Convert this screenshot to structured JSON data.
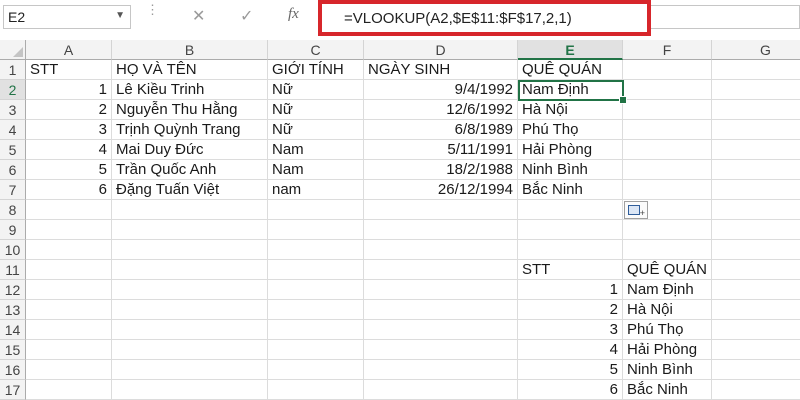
{
  "name_box": {
    "value": "E2"
  },
  "formula_bar": {
    "cancel_icon": "x-icon",
    "enter_icon": "check-icon",
    "fx_label": "fx",
    "formula": "=VLOOKUP(A2,$E$11:$F$17,2,1)"
  },
  "columns": [
    "A",
    "B",
    "C",
    "D",
    "E",
    "F",
    "G"
  ],
  "rows": [
    "1",
    "2",
    "3",
    "4",
    "5",
    "6",
    "7",
    "8",
    "9",
    "10",
    "11",
    "12",
    "13",
    "14",
    "15",
    "16",
    "17"
  ],
  "selected_cell": "E2",
  "headers": {
    "stt": "STT",
    "name": "HỌ VÀ TÊN",
    "gender": "GIỚI TÍNH",
    "dob": "NGÀY SINH",
    "hometown": "QUÊ QUÁN"
  },
  "people": [
    {
      "stt": "1",
      "name": "Lê Kiều Trinh",
      "gender": "Nữ",
      "dob": "9/4/1992",
      "hometown": "Nam Định"
    },
    {
      "stt": "2",
      "name": "Nguyễn Thu Hằng",
      "gender": "Nữ",
      "dob": "12/6/1992",
      "hometown": "Hà Nội"
    },
    {
      "stt": "3",
      "name": "Trịnh Quỳnh Trang",
      "gender": "Nữ",
      "dob": "6/8/1989",
      "hometown": "Phú Thọ"
    },
    {
      "stt": "4",
      "name": "Mai Duy Đức",
      "gender": "Nam",
      "dob": "5/11/1991",
      "hometown": "Hải Phòng"
    },
    {
      "stt": "5",
      "name": "Trần Quốc Anh",
      "gender": "Nam",
      "dob": "18/2/1988",
      "hometown": "Ninh Bình"
    },
    {
      "stt": "6",
      "name": "Đặng Tuấn Việt",
      "gender": "nam",
      "dob": "26/12/1994",
      "hometown": "Bắc Ninh"
    }
  ],
  "lookup_headers": {
    "stt": "STT",
    "hometown": "QUÊ QUÁN"
  },
  "lookup": [
    {
      "stt": "1",
      "hometown": "Nam Định"
    },
    {
      "stt": "2",
      "hometown": "Hà Nội"
    },
    {
      "stt": "3",
      "hometown": "Phú Thọ"
    },
    {
      "stt": "4",
      "hometown": "Hải Phòng"
    },
    {
      "stt": "5",
      "hometown": "Ninh Bình"
    },
    {
      "stt": "6",
      "hometown": "Bắc Ninh"
    }
  ],
  "paste_options_icon": "paste-options-icon",
  "colors": {
    "accent": "#217346",
    "highlight_border": "#d7262b"
  }
}
